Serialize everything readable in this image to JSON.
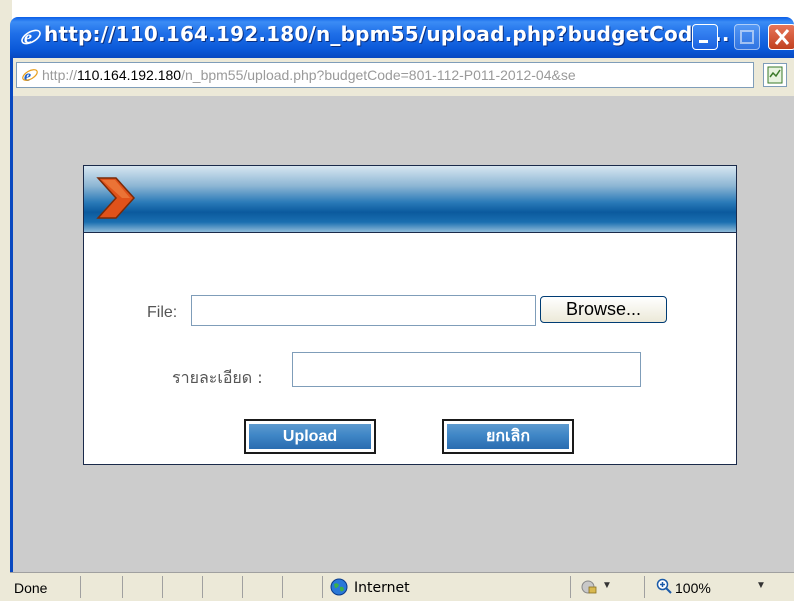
{
  "window": {
    "title": "http://110.164.192.180/n_bpm55/upload.php?budgetCode...",
    "minimize_label": "_",
    "maximize_label": "□",
    "close_label": "✕"
  },
  "address": {
    "prefix": "http://",
    "host": "110.164.192.180",
    "path": "/n_bpm55/upload.php?budgetCode=801-112-P011-2012-04&se"
  },
  "form": {
    "file_label": "File:",
    "file_value": "",
    "browse_label": "Browse...",
    "detail_label": "รายละเอียด :",
    "detail_value": "",
    "upload_label": "Upload",
    "cancel_label": "ยกเลิก"
  },
  "statusbar": {
    "status": "Done",
    "zone": "Internet",
    "zoom": "100%"
  },
  "colors": {
    "titlebar": "#0a58d8",
    "content_bg": "#cccccc",
    "button_blue": "#3f86c6",
    "chevron_orange": "#e0521a"
  }
}
